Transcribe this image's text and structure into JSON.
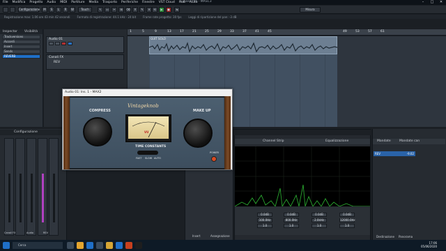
{
  "window": {
    "title": "Cubase Pro - MASC3",
    "menu": [
      "File",
      "Modifica",
      "Progetto",
      "Audio",
      "MIDI",
      "Partiture",
      "Media",
      "Trasporto",
      "Periferiche",
      "Finestre",
      "VST Cloud",
      "Hub",
      "Aiuto"
    ]
  },
  "toolbar": {
    "config_label": "Configurazione",
    "touch_label": "Touch",
    "grid_label": "Misura"
  },
  "infobar": {
    "items": [
      "Registrazione max: 1.06 ore 43 min 42 secondi",
      "Formato di registrazione: 44.1 kHz - 24 bit",
      "Frame rate progetto: 30 fps",
      "Leggi di ripartizione del pan: -3 dB"
    ]
  },
  "inspector": {
    "tab1": "Inspector",
    "tab2": "Visibilità",
    "rows": [
      "Trackversions",
      "Accordi",
      "Insert",
      "Sends"
    ],
    "selected": "REVERB"
  },
  "tracks": [
    {
      "name": "Audio 01",
      "number": "1"
    },
    {
      "name": "Canali FX",
      "sub": "REV",
      "number": "2"
    }
  ],
  "ruler": {
    "marks": [
      "1",
      "5",
      "9",
      "13",
      "17",
      "21",
      "25",
      "29",
      "33",
      "37",
      "41",
      "45",
      "49",
      "53",
      "57",
      "61"
    ]
  },
  "event": {
    "label": "GUIT SOLO"
  },
  "mixer": {
    "title": "Configurazione",
    "channels": [
      "Audio 01",
      "REV",
      "Stereo Out"
    ],
    "footer": [
      "Canali FX",
      "Audio",
      "REV"
    ]
  },
  "mediabay": {
    "tabs": [
      "Insert",
      "Assegnazione"
    ]
  },
  "eq": {
    "tab_strip": "Channel Strip",
    "tab_eq": "Equalizzazione",
    "bands": [
      {
        "gain": "0.0dB",
        "freq": "100.0Hz",
        "q": "1.0"
      },
      {
        "gain": "0.0dB",
        "freq": "800.0Hz",
        "q": "1.0"
      },
      {
        "gain": "0.0dB",
        "freq": "2.0kHz",
        "q": "1.0"
      },
      {
        "gain": "0.0dB",
        "freq": "12000.0Hz",
        "q": "1.0"
      }
    ],
    "footer_tabs": [
      "Onde",
      "Fase",
      "Spettro"
    ]
  },
  "sends": {
    "header_left": "Mandate",
    "header_right": "Mandate can",
    "row": "REV",
    "value": "-9.02",
    "footer": [
      "Destinazione",
      "Panorama"
    ]
  },
  "plugin": {
    "window_title": "Audio 01: Ins. 1 - MAX2",
    "brand": "Vintageknob",
    "compress_label": "COMPRESS",
    "makeup_label": "MAKE UP",
    "tc_label": "TIME CONSTANTS",
    "tc_options": [
      "FAST",
      "SLOW",
      "AUTO"
    ],
    "power_label": "POWER",
    "vu_label": "VU"
  },
  "taskbar": {
    "search_placeholder": "Cerca",
    "time": "17:06",
    "date": "05/06/2020"
  }
}
